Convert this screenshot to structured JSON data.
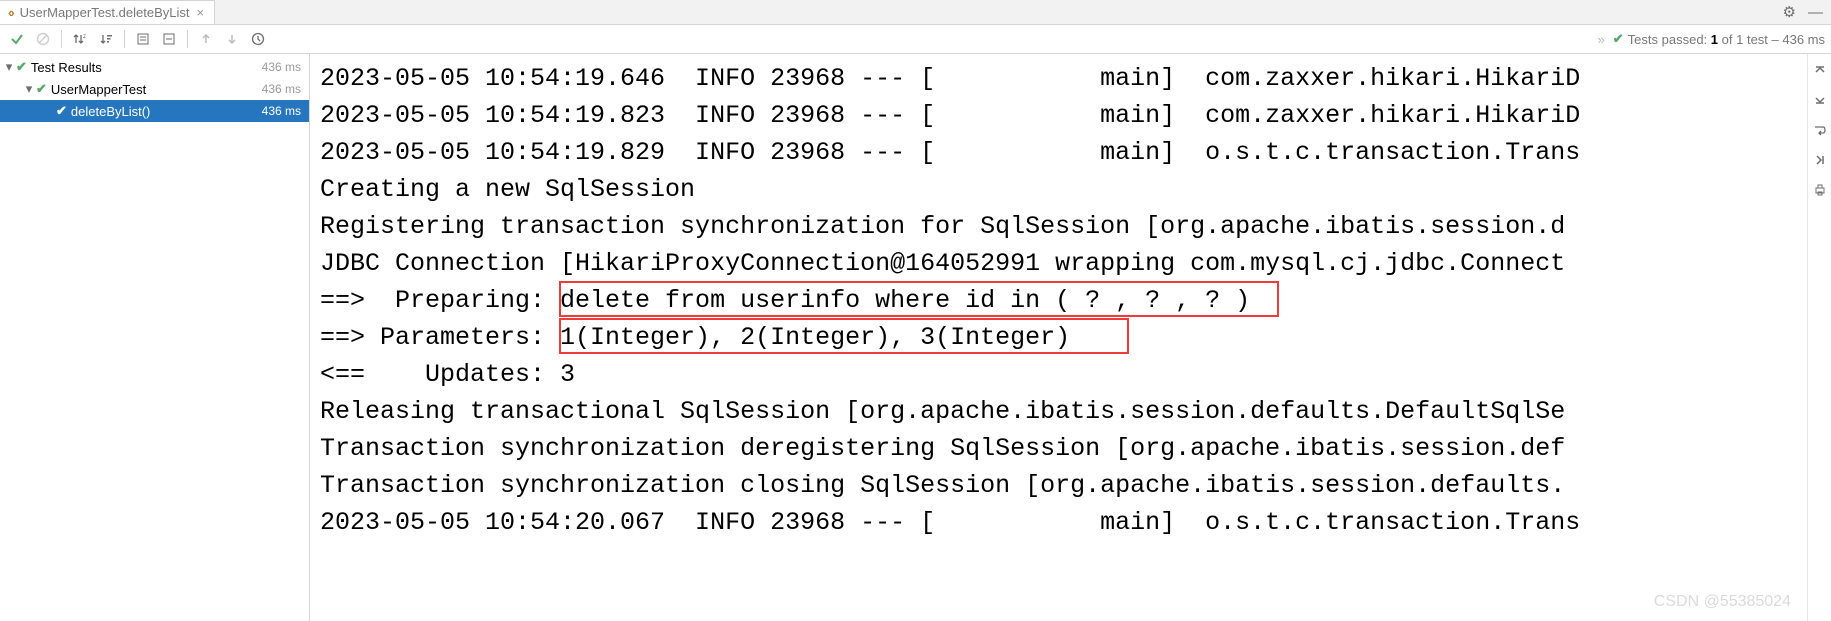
{
  "tab": {
    "title": "UserMapperTest.deleteByList"
  },
  "status": {
    "prefix": "Tests passed:",
    "bold": "1",
    "rest": "of 1 test – 436 ms"
  },
  "tree": {
    "root": {
      "label": "Test Results",
      "ms": "436 ms"
    },
    "class": {
      "label": "UserMapperTest",
      "ms": "436 ms"
    },
    "method": {
      "label": "deleteByList()",
      "ms": "436 ms"
    }
  },
  "console": {
    "lines": [
      "2023-05-05 10:54:19.646  INFO 23968 --- [           main]  com.zaxxer.hikari.HikariD",
      "2023-05-05 10:54:19.823  INFO 23968 --- [           main]  com.zaxxer.hikari.HikariD",
      "2023-05-05 10:54:19.829  INFO 23968 --- [           main]  o.s.t.c.transaction.Trans",
      "Creating a new SqlSession",
      "Registering transaction synchronization for SqlSession [org.apache.ibatis.session.d",
      "JDBC Connection [HikariProxyConnection@164052991 wrapping com.mysql.cj.jdbc.Connect",
      "==>  Preparing: delete from userinfo where id in ( ? , ? , ? )",
      "==> Parameters: 1(Integer), 2(Integer), 3(Integer)",
      "<==    Updates: 3",
      "Releasing transactional SqlSession [org.apache.ibatis.session.defaults.DefaultSqlSe",
      "Transaction synchronization deregistering SqlSession [org.apache.ibatis.session.def",
      "Transaction synchronization closing SqlSession [org.apache.ibatis.session.defaults.",
      "2023-05-05 10:54:20.067  INFO 23968 --- [           main]  o.s.t.c.transaction.Trans"
    ]
  },
  "watermark": "CSDN @55385024"
}
